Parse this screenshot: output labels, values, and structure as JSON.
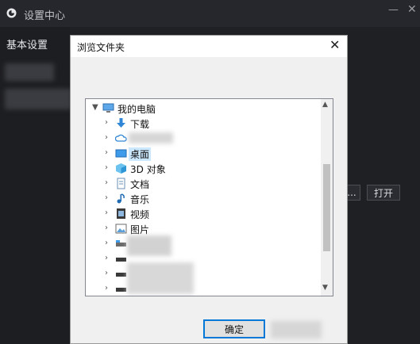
{
  "window": {
    "title": "设置中心",
    "minimize": "—",
    "close": "✕"
  },
  "sidebar": {
    "items": [
      {
        "label": "基本设置"
      }
    ]
  },
  "settings": {
    "browse_label": "...",
    "open_label": "打开"
  },
  "dialog": {
    "title": "浏览文件夹",
    "close": "✕",
    "ok_label": "确定",
    "tree": {
      "root": {
        "label": "我的电脑",
        "icon": "computer-icon",
        "expanded": true
      },
      "items": [
        {
          "label": "下载",
          "icon": "download-icon",
          "selected": false
        },
        {
          "label": "",
          "icon": "cloud-icon",
          "selected": false
        },
        {
          "label": "桌面",
          "icon": "desktop-icon",
          "selected": true
        },
        {
          "label": "3D 对象",
          "icon": "3d-objects-icon",
          "selected": false
        },
        {
          "label": "文档",
          "icon": "document-icon",
          "selected": false
        },
        {
          "label": "音乐",
          "icon": "music-icon",
          "selected": false
        },
        {
          "label": "视频",
          "icon": "video-icon",
          "selected": false
        },
        {
          "label": "图片",
          "icon": "picture-icon",
          "selected": false
        },
        {
          "label": "",
          "icon": "drive-icon",
          "selected": false
        },
        {
          "label": "",
          "icon": "drive-icon",
          "selected": false
        },
        {
          "label": "",
          "icon": "drive-icon",
          "selected": false
        },
        {
          "label": "",
          "icon": "drive-icon",
          "selected": false
        }
      ]
    }
  },
  "colors": {
    "accent": "#0078d7",
    "selection": "#cce8ff",
    "dark_bg": "#1f2024"
  }
}
